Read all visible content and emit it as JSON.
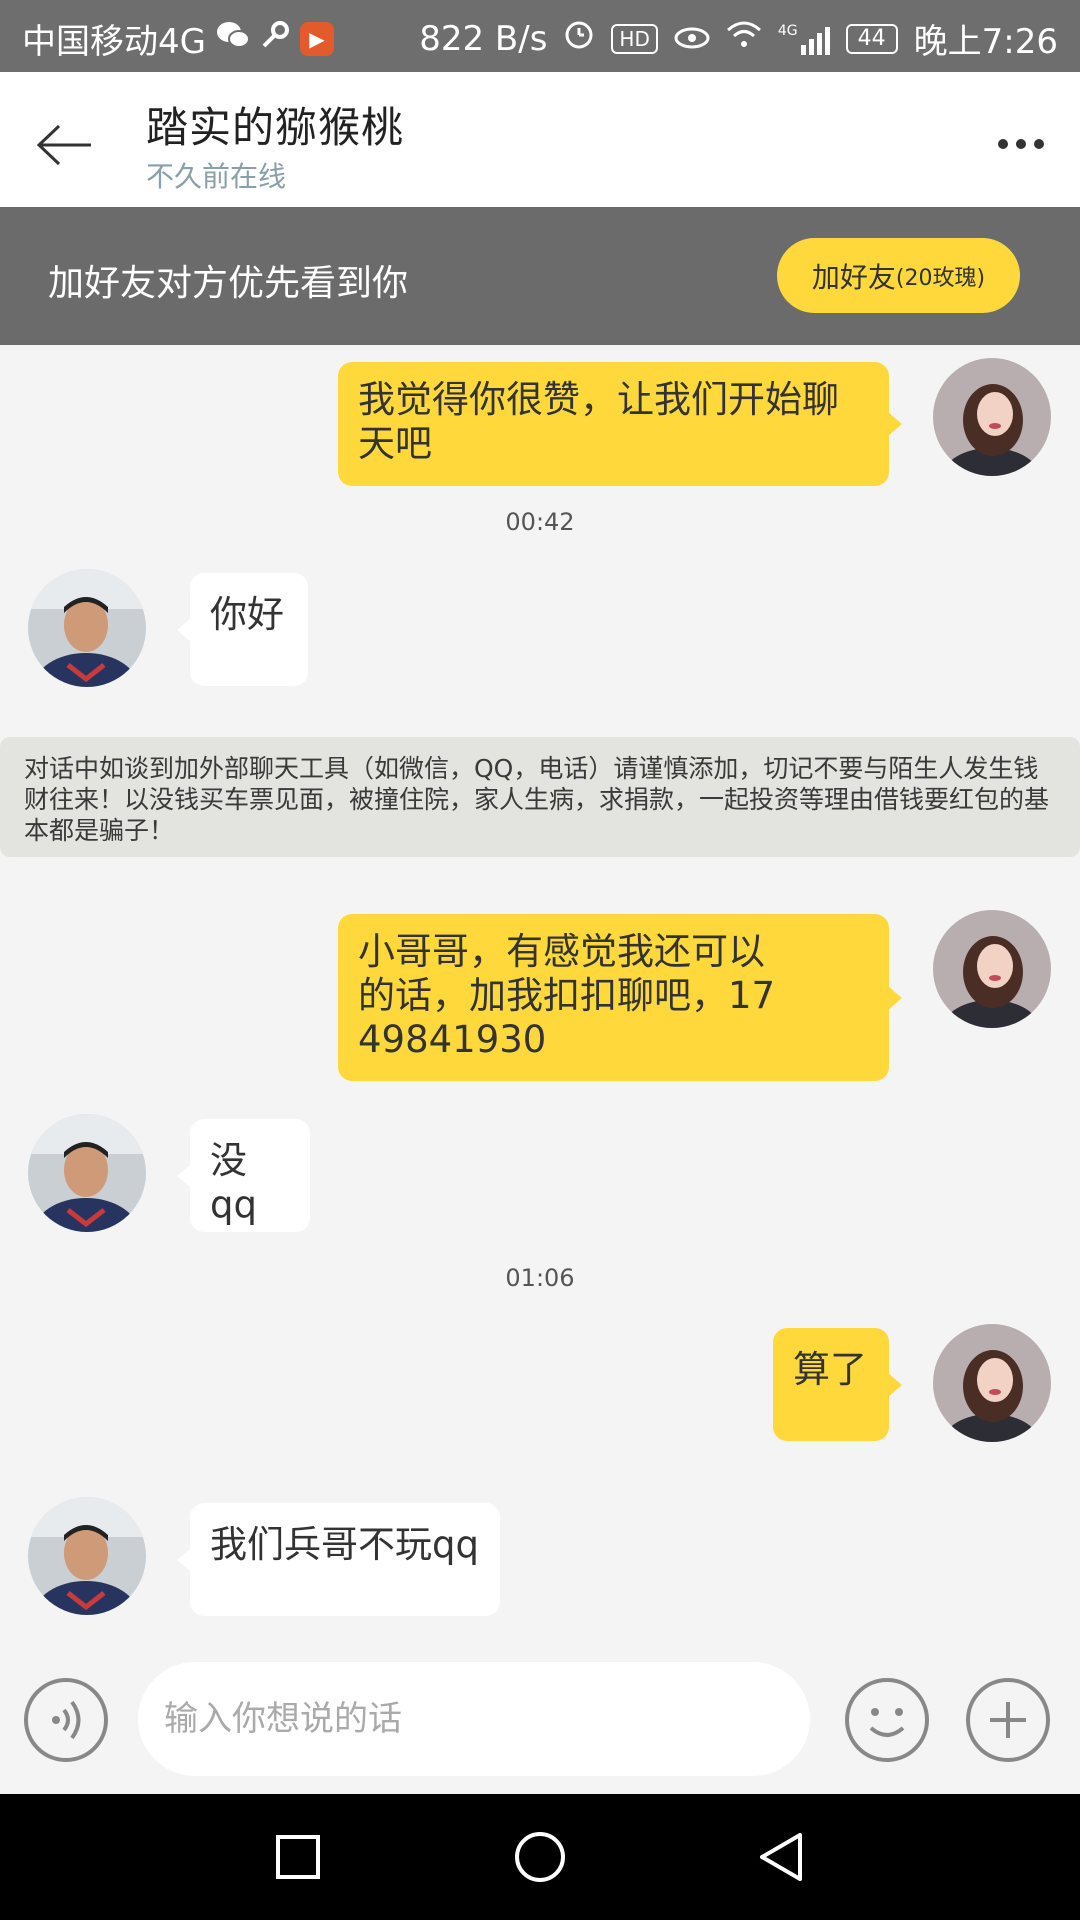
{
  "status_bar": {
    "carrier": "中国移动4G",
    "net_speed": "822 B/s",
    "hd_label": "HD",
    "network_type": "4G",
    "battery": "44",
    "time": "晚上7:26"
  },
  "header": {
    "title": "踏实的猕猴桃",
    "subtitle": "不久前在线"
  },
  "promo": {
    "text": "加好友对方优先看到你",
    "button_main": "加好友",
    "button_sub": "(20玫瑰)"
  },
  "messages": [
    {
      "side": "out",
      "text": "我觉得你很赞，让我们开始聊天吧"
    },
    {
      "timestamp": "00:42"
    },
    {
      "side": "in",
      "text": "你好"
    },
    {
      "warning": "对话中如谈到加外部聊天工具（如微信，QQ，电话）请谨慎添加，切记不要与陌生人发生钱财往来！以没钱买车票见面，被撞住院，家人生病，求捐款，一起投资等理由借钱要红包的基本都是骗子！"
    },
    {
      "side": "out",
      "text": "小哥哥，有感觉我还可以的话，加我扣扣聊吧，1749841930"
    },
    {
      "side": "in",
      "text": "没qq"
    },
    {
      "timestamp": "01:06"
    },
    {
      "side": "out",
      "text": "算了"
    },
    {
      "side": "in",
      "text": "我们兵哥不玩qq"
    }
  ],
  "input": {
    "placeholder": "输入你想说的话"
  },
  "colors": {
    "accent_yellow": "#ffd93c",
    "band_gray": "#6b6b6b",
    "background": "#f4f4f4"
  },
  "icons": [
    "back-arrow-icon",
    "more-icon",
    "voice-icon",
    "emoji-icon",
    "plus-icon",
    "nav-recent-icon",
    "nav-home-icon",
    "nav-back-icon"
  ]
}
